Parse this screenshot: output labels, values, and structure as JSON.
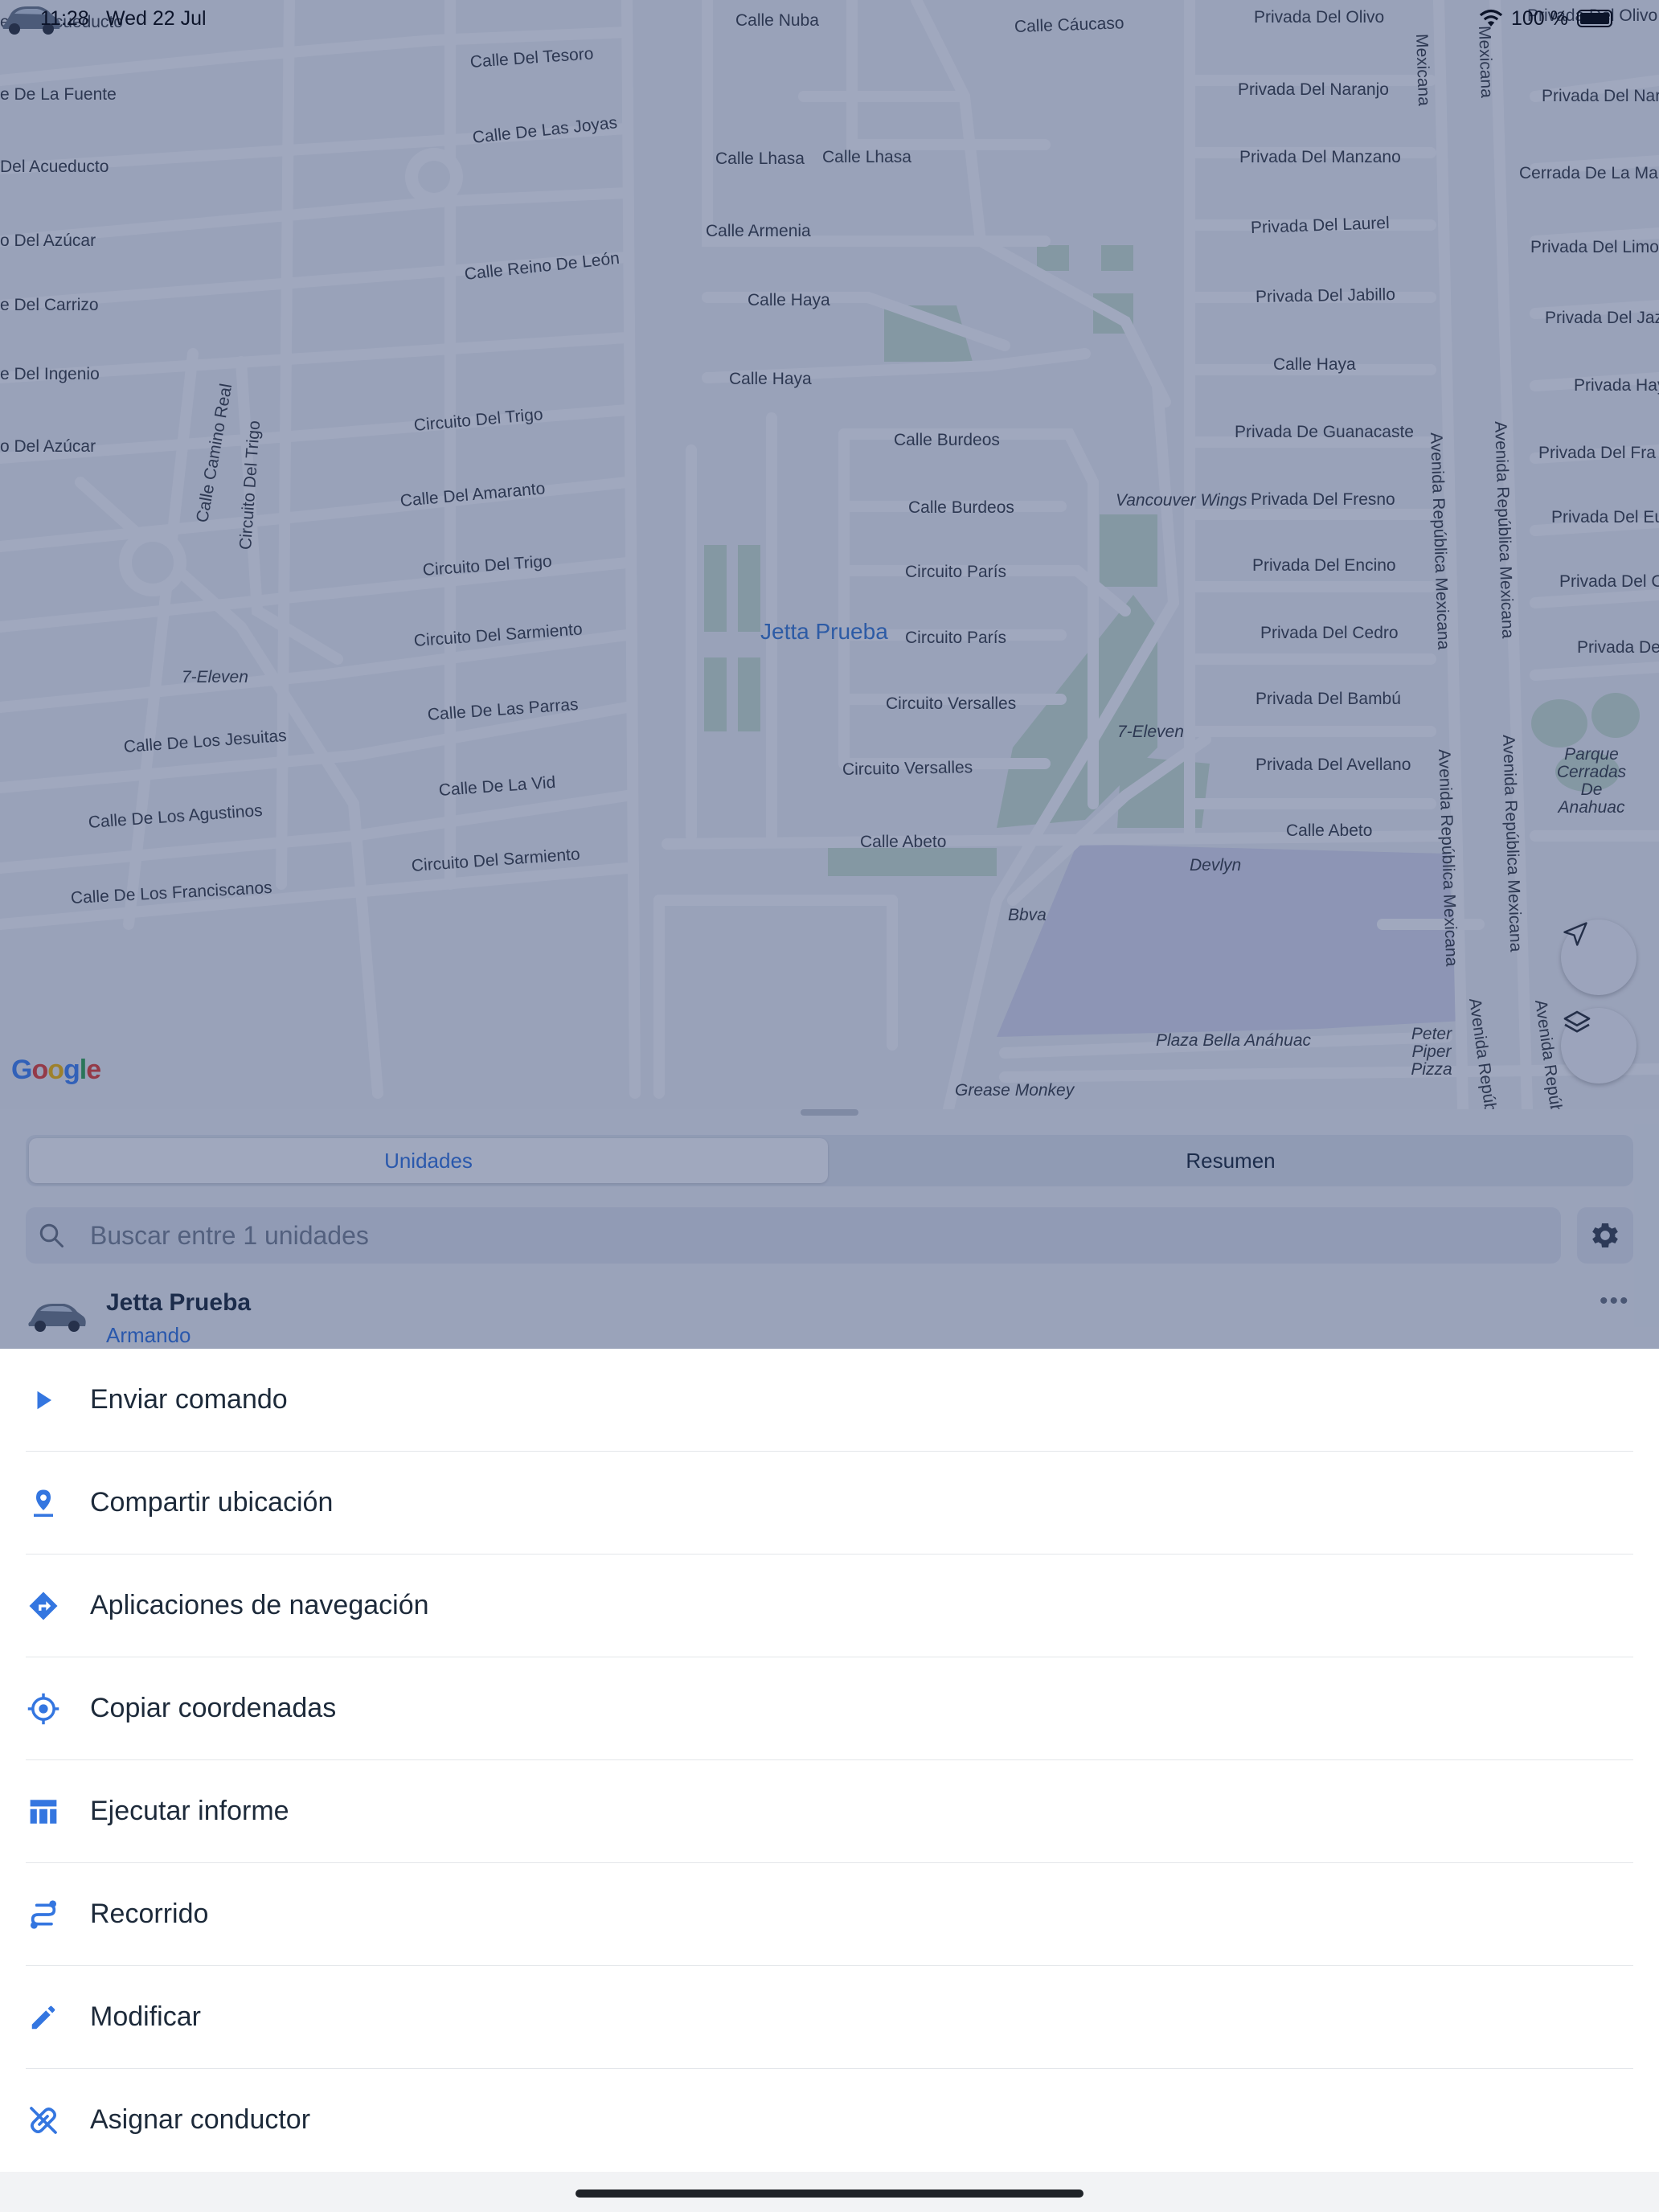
{
  "status_bar": {
    "time": "11:28",
    "date": "Wed 22 Jul",
    "battery": "100 %"
  },
  "map": {
    "attribution": "Google",
    "vehicle_label": "Jetta Prueba",
    "streets": [
      "Calle Nuba",
      "Calle Cáucaso",
      "Privada Del Olivo",
      "Calle Del Tesoro",
      "Calle De Las Joyas",
      "Privada Del Naranjo",
      "Privada Del Manzano",
      "Privada Del Laurel",
      "Privada Del Jabillo",
      "Calle Lhasa",
      "Calle Lhasa",
      "Calle Armenia",
      "Calle Haya",
      "Calle Haya",
      "Calle Haya",
      "Calle Reino De León",
      "Circuito Del Trigo",
      "Calle Del Amaranto",
      "Circuito Del Trigo",
      "Circuito Del Sarmiento",
      "Calle De Las Parras",
      "Calle De La Vid",
      "Circuito Del Sarmiento",
      "Calle Burdeos",
      "Calle Burdeos",
      "Circuito París",
      "Circuito París",
      "Circuito Versalles",
      "Circuito Versalles",
      "Calle Abeto",
      "Calle Abeto",
      "Privada De Guanacaste",
      "Privada Del Fresno",
      "Privada Del Encino",
      "Privada Del Cedro",
      "Privada Del Bambú",
      "Privada Del Avellano",
      "Calle De Los Jesuitas",
      "Calle De Los Agustinos",
      "Calle De Los Franciscanos",
      "Calle Camino Real",
      "Circuito Del Trigo",
      "Avenida República Mexicana",
      "Avenida República Mexicana",
      "Avenida República Mexicana",
      "Avenida República Mexicana",
      "Avenida República Mexicana",
      "Avenida República Mexicana",
      "Privada Del Olivo",
      "Privada Del Naranjo",
      "Cerrada De La Ma",
      "Privada Del Limo",
      "Privada Del Jaz",
      "Privada Hay",
      "Privada Del Fra",
      "Privada Del Eu",
      "Privada Del C",
      "Privada Del B",
      "e Del Acueducto",
      "e De La Fuente",
      "Del Acueducto",
      "o Del Azúcar",
      "e Del Carrizo",
      "e Del Ingenio",
      "o Del Azúcar",
      "Mexicana",
      "Mexicana"
    ],
    "pois": [
      "Vancouver Wings",
      "7-Eleven",
      "7-Eleven",
      "Devlyn",
      "Bbva",
      "Plaza Bella Anáhuac",
      "Grease Monkey",
      "Peter Piper Pizza",
      "Parque Cerradas De Anahuac"
    ]
  },
  "panel": {
    "tabs": [
      {
        "label": "Unidades",
        "selected": true
      },
      {
        "label": "Resumen",
        "selected": false
      }
    ],
    "search_placeholder": "Buscar entre 1 unidades",
    "unit": {
      "name": "Jetta Prueba",
      "status": "Armando"
    }
  },
  "action_sheet": {
    "items": [
      {
        "label": "Enviar comando",
        "icon": "play-icon"
      },
      {
        "label": "Compartir ubicación",
        "icon": "location-pin-icon"
      },
      {
        "label": "Aplicaciones de navegación",
        "icon": "directions-icon"
      },
      {
        "label": "Copiar coordenadas",
        "icon": "crosshair-icon"
      },
      {
        "label": "Ejecutar informe",
        "icon": "table-icon"
      },
      {
        "label": "Recorrido",
        "icon": "route-icon"
      },
      {
        "label": "Modificar",
        "icon": "pencil-icon"
      },
      {
        "label": "Asignar conductor",
        "icon": "link-icon"
      }
    ]
  },
  "colors": {
    "accent": "#3476e0",
    "overlay": "rgba(28,48,100,0.42)",
    "map_background": "#f3f4f6",
    "map_road": "#ffffff",
    "park": "#cfe3d0"
  }
}
